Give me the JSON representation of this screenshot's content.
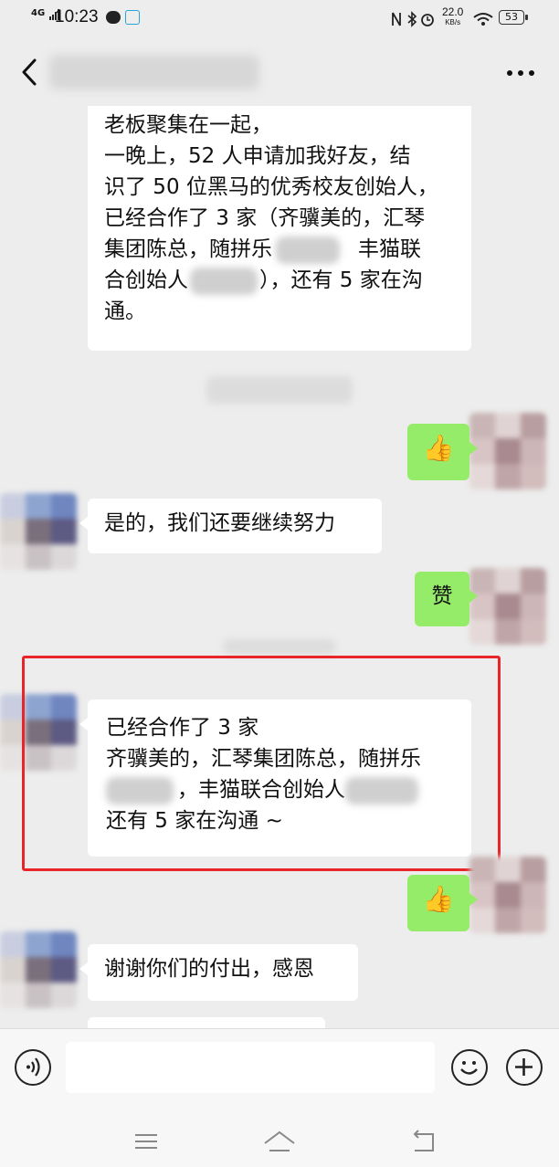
{
  "status_bar": {
    "network": "4G",
    "time": "10:23",
    "speed_value": "22.0",
    "speed_unit": "KB/s",
    "battery": "53"
  },
  "header": {
    "back_icon": "chevron-left-icon",
    "more_icon": "more-dots-icon"
  },
  "messages": [
    {
      "side": "left",
      "lines": [
        "老板聚集在一起，",
        "一晚上，52 人申请加我好友，结",
        "识了 50 位黑马的优秀校友创始人，",
        "已经合作了 3 家（齐骥美的，汇琴",
        "集团陈总，随拼乐",
        "丰猫联",
        "合创始人",
        "），还有 5 家在沟",
        "通。"
      ]
    },
    {
      "side": "right",
      "icon": "thumbs-up-icon",
      "emoji": "👍"
    },
    {
      "side": "left",
      "text": "是的，我们还要继续努力"
    },
    {
      "side": "right",
      "text": "赞"
    },
    {
      "side": "left",
      "highlighted": true,
      "lines": [
        "已经合作了 3 家",
        "齐骥美的，汇琴集团陈总，随拼乐",
        "，丰猫联合创始人",
        "还有 5 家在沟通 ~"
      ]
    },
    {
      "side": "right",
      "icon": "thumbs-up-icon",
      "emoji": "👍"
    },
    {
      "side": "left",
      "text": "谢谢你们的付出，感恩"
    }
  ],
  "colors": {
    "background": "#ededed",
    "bubble_incoming": "#ffffff",
    "bubble_outgoing": "#95ec69",
    "highlight_border": "#e8262a"
  },
  "input_bar": {
    "voice_icon": "voice-icon",
    "emoji_icon": "emoji-icon",
    "plus_icon": "plus-icon"
  },
  "nav_bar": {
    "menu_icon": "menu-icon",
    "home_icon": "home-icon",
    "back_icon": "back-icon"
  }
}
